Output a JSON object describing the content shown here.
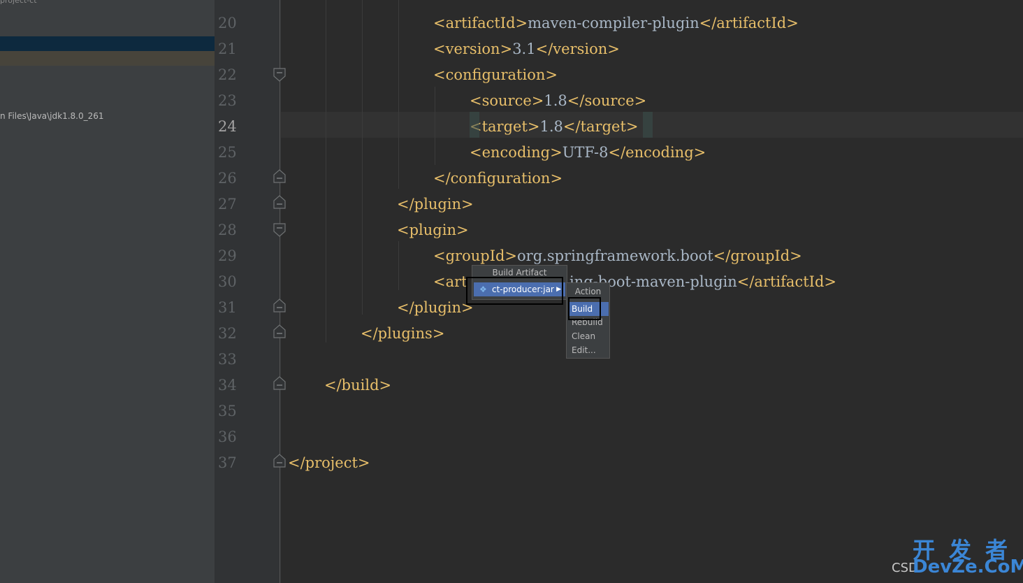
{
  "sidebar": {
    "top_label": "project-ct",
    "path_text": "n Files\\Java\\jdk1.8.0_261"
  },
  "editor": {
    "current_line": 24,
    "lines": [
      {
        "n": "20",
        "open": "<artifactId>",
        "text": "maven-compiler-plugin",
        "close": "</artifactId>"
      },
      {
        "n": "21",
        "open": "<version>",
        "text": "3.1",
        "close": "</version>"
      },
      {
        "n": "22",
        "open": "<configuration>",
        "text": "",
        "close": ""
      },
      {
        "n": "23",
        "open": "<source>",
        "text": "1.8",
        "close": "</source>"
      },
      {
        "n": "24",
        "open": "<target>",
        "text": "1.8",
        "close": "</target>"
      },
      {
        "n": "25",
        "open": "<encoding>",
        "text": "UTF-8",
        "close": "</encoding>"
      },
      {
        "n": "26",
        "open": "</configuration>",
        "text": "",
        "close": ""
      },
      {
        "n": "27",
        "open": "</plugin>",
        "text": "",
        "close": ""
      },
      {
        "n": "28",
        "open": "<plugin>",
        "text": "",
        "close": ""
      },
      {
        "n": "29",
        "open": "<groupId>",
        "text": "org.springframework.boot",
        "close": "</groupId>"
      },
      {
        "n": "30",
        "open": "<art",
        "text": "ing-boot-maven-plugin",
        "close": "</artifactId>"
      },
      {
        "n": "31",
        "open": "</plugin>",
        "text": "",
        "close": ""
      },
      {
        "n": "32",
        "open": "</plugins>",
        "text": "",
        "close": ""
      },
      {
        "n": "33",
        "open": "",
        "text": "",
        "close": ""
      },
      {
        "n": "34",
        "open": "</build>",
        "text": "",
        "close": ""
      },
      {
        "n": "35",
        "open": "",
        "text": "",
        "close": ""
      },
      {
        "n": "36",
        "open": "",
        "text": "",
        "close": ""
      },
      {
        "n": "37",
        "open": "</project>",
        "text": "",
        "close": ""
      }
    ]
  },
  "build_artifact_menu": {
    "title": "Build Artifact",
    "item": "ct-producer:jar",
    "item_icon": "artifact-icon"
  },
  "action_menu": {
    "title": "Action",
    "items": [
      "Build",
      "Rebuild",
      "Clean",
      "Edit..."
    ],
    "selected": "Build"
  },
  "watermark": {
    "csdn": "CSD",
    "cn": "开发者",
    "en": "DevZe.CoM"
  },
  "colors": {
    "editor_bg": "#2b2b2b",
    "tag": "#e8bf6a",
    "text": "#a9b7c6",
    "selection": "#4b6eaf"
  }
}
